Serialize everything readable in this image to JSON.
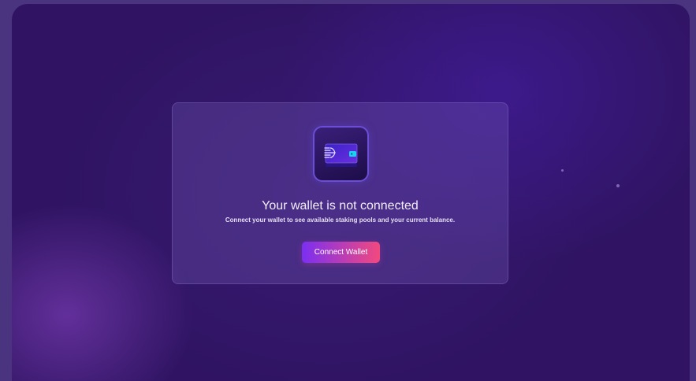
{
  "wallet_prompt": {
    "icon": "wallet-card-icon",
    "title": "Your wallet is not connected",
    "message": "Connect your wallet to see available staking pools and your current balance.",
    "button_label": "Connect Wallet"
  },
  "colors": {
    "page_bg": "#4a3480",
    "frame_bg": "#301463",
    "button_gradient_start": "#7b2ff2",
    "button_gradient_end": "#f2497e",
    "icon_border": "#6a4ed6",
    "card_accent": "#18d4f0"
  }
}
